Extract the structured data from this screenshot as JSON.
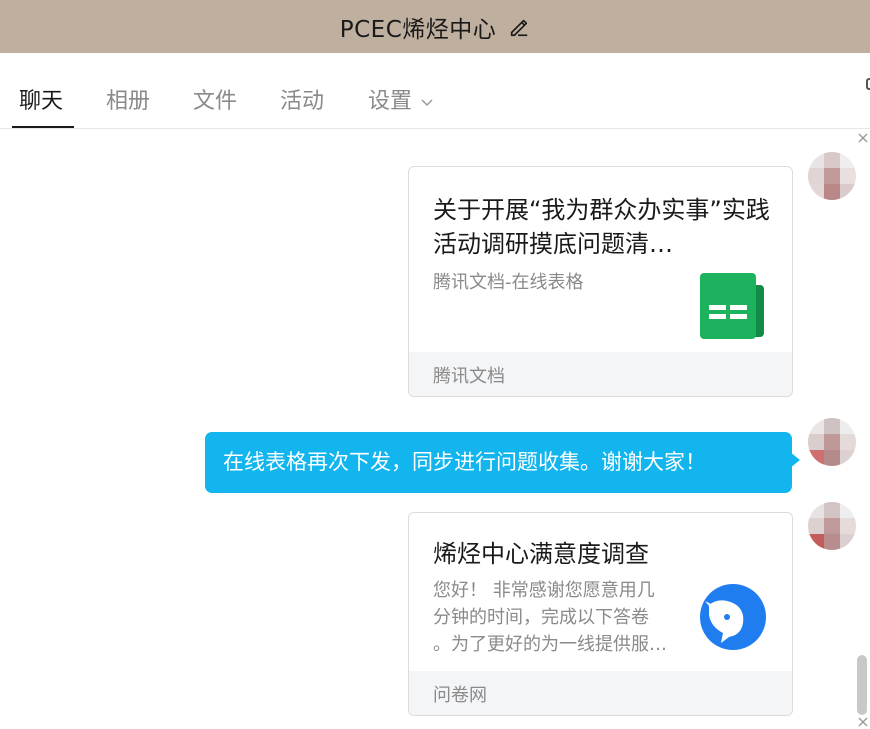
{
  "header": {
    "title": "PCEC烯烃中心"
  },
  "tabs": [
    {
      "label": "聊天"
    },
    {
      "label": "相册"
    },
    {
      "label": "文件"
    },
    {
      "label": "活动"
    },
    {
      "label": "设置"
    }
  ],
  "messages": {
    "card1": {
      "title": "关于开展“我为群众办实事”实践活动调研摸底问题清…",
      "subtitle": "腾讯文档-在线表格",
      "source": "腾讯文档",
      "icon": "spreadsheet-icon",
      "icon_color": "#1db35e"
    },
    "bubble": {
      "text": "在线表格再次下发，同步进行问题收集。谢谢大家！",
      "color": "#13b5ef"
    },
    "card2": {
      "title": "烯烃中心满意度调查",
      "desc_lines": [
        "您好！ 非常感谢您愿意用几",
        "分钟的时间，完成以下答卷",
        "。为了更好的为一线提供服…"
      ],
      "source": "问卷网",
      "icon": "wenjuan-logo-icon",
      "icon_color": "#1f7df0"
    }
  },
  "colors": {
    "titlebar": "#bfaf9e",
    "accent": "#13b5ef"
  }
}
